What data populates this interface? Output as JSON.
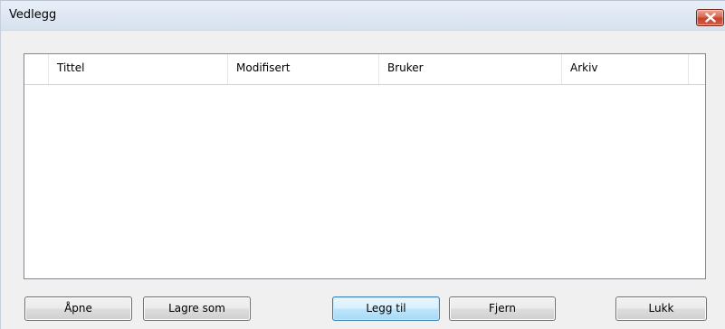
{
  "window": {
    "title": "Vedlegg",
    "close_icon": "close-x-icon"
  },
  "table": {
    "columns": [
      "",
      "Tittel",
      "Modifisert",
      "Bruker",
      "Arkiv"
    ],
    "rows": []
  },
  "buttons": {
    "open": "Åpne",
    "save_as": "Lagre som",
    "add": "Legg til",
    "remove": "Fjern",
    "close": "Lukk"
  },
  "colors": {
    "close_button": "#c7402a",
    "default_button_border": "#3c7fb1"
  }
}
